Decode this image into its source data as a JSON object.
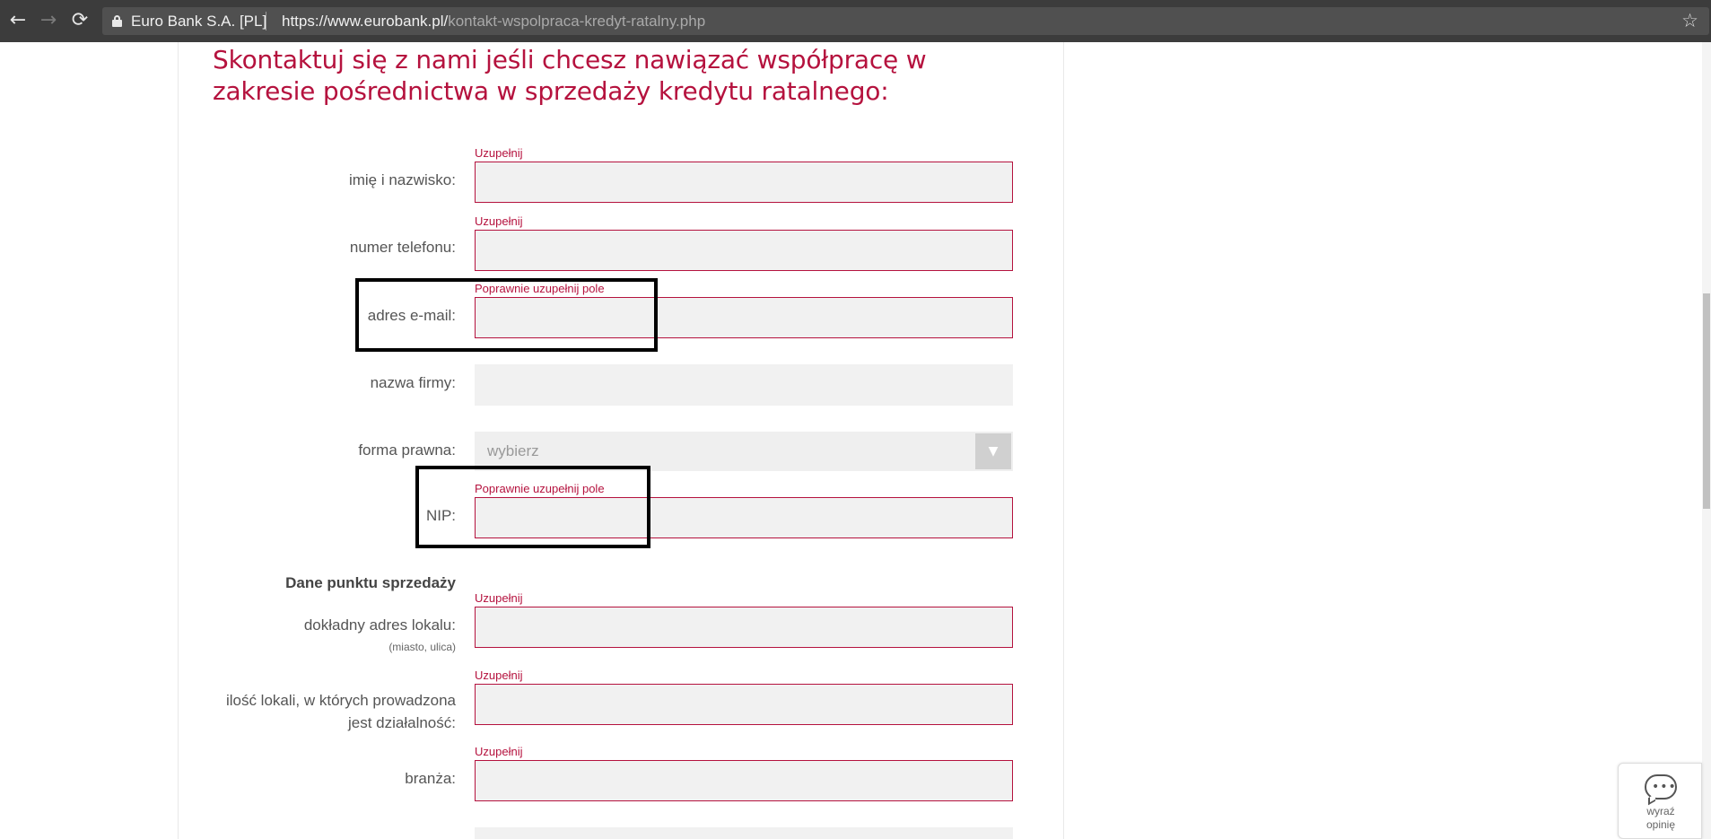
{
  "browser": {
    "site_name": "Euro Bank S.A. [PL]",
    "url_host": "https://www.eurobank.pl/",
    "url_path": "kontakt-wspolpraca-kredyt-ratalny.php",
    "back_icon": "←",
    "forward_icon": "→",
    "reload_icon": "⟳",
    "star_icon": "☆"
  },
  "form": {
    "heading": "Skontaktuj się z nami jeśli chcesz nawiązać współpracę w zakresie pośrednictwa w sprzedaży kredytu ratalnego:",
    "fields": {
      "name": {
        "label": "imię i nazwisko:",
        "error": "Uzupełnij"
      },
      "phone": {
        "label": "numer telefonu:",
        "error": "Uzupełnij"
      },
      "email": {
        "label": "adres e-mail:",
        "error": "Poprawnie uzupełnij pole"
      },
      "company": {
        "label": "nazwa firmy:"
      },
      "legal_form": {
        "label": "forma prawna:",
        "selected": "wybierz",
        "arrow": "▼"
      },
      "nip": {
        "label": "NIP:",
        "error": "Poprawnie uzupełnij pole"
      }
    },
    "section_title": "Dane punktu sprzedaży",
    "sale_point": {
      "address": {
        "label": "dokładny adres lokalu:",
        "hint": "(miasto, ulica)",
        "error": "Uzupełnij"
      },
      "locations": {
        "label_line1": "ilość lokali, w których prowadzona",
        "label_line2": "jest działalność:",
        "error": "Uzupełnij"
      },
      "industry": {
        "label": "branża:",
        "error": "Uzupełnij"
      }
    }
  },
  "feedback": {
    "line1": "wyraź",
    "line2": "opinię",
    "dots": "•••"
  },
  "colors": {
    "accent": "#b5123e",
    "chrome": "#3c3c3c"
  }
}
